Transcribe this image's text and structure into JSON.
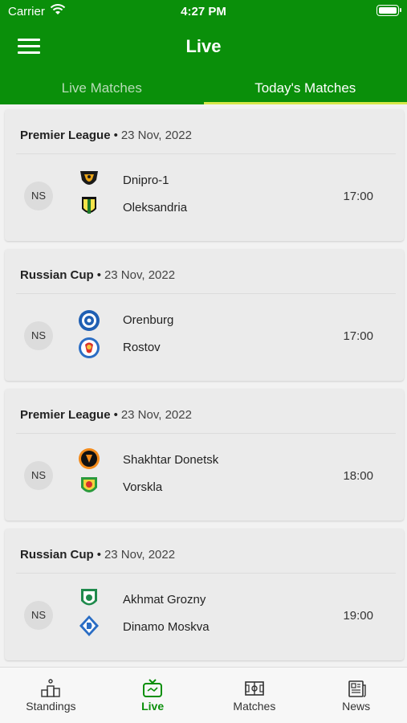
{
  "status_bar": {
    "carrier": "Carrier",
    "time": "4:27 PM"
  },
  "header": {
    "title": "Live"
  },
  "tabs": [
    {
      "label": "Live Matches",
      "active": false
    },
    {
      "label": "Today's Matches",
      "active": true
    }
  ],
  "matches": [
    {
      "league": "Premier League",
      "date": "23 Nov, 2022",
      "status": "NS",
      "home": {
        "name": "Dnipro-1",
        "logo": "dnipro-1-crest"
      },
      "away": {
        "name": "Oleksandria",
        "logo": "oleksandria-crest"
      },
      "time": "17:00"
    },
    {
      "league": "Russian Cup",
      "date": "23 Nov, 2022",
      "status": "NS",
      "home": {
        "name": "Orenburg",
        "logo": "orenburg-crest"
      },
      "away": {
        "name": "Rostov",
        "logo": "rostov-crest"
      },
      "time": "17:00"
    },
    {
      "league": "Premier League",
      "date": "23 Nov, 2022",
      "status": "NS",
      "home": {
        "name": "Shakhtar Donetsk",
        "logo": "shakhtar-donetsk-crest"
      },
      "away": {
        "name": "Vorskla",
        "logo": "vorskla-crest"
      },
      "time": "18:00"
    },
    {
      "league": "Russian Cup",
      "date": "23 Nov, 2022",
      "status": "NS",
      "home": {
        "name": "Akhmat Grozny",
        "logo": "akhmat-grozny-crest"
      },
      "away": {
        "name": "Dinamo Moskva",
        "logo": "dinamo-moskva-crest"
      },
      "time": "19:00"
    }
  ],
  "bottom_nav": [
    {
      "label": "Standings",
      "icon": "podium-icon",
      "active": false
    },
    {
      "label": "Live",
      "icon": "tv-icon",
      "active": true
    },
    {
      "label": "Matches",
      "icon": "pitch-icon",
      "active": false
    },
    {
      "label": "News",
      "icon": "newspaper-icon",
      "active": false
    }
  ],
  "colors": {
    "brand_green": "#0a8f0a",
    "tab_indicator": "#d6e84a",
    "card_bg": "#ebebeb"
  }
}
